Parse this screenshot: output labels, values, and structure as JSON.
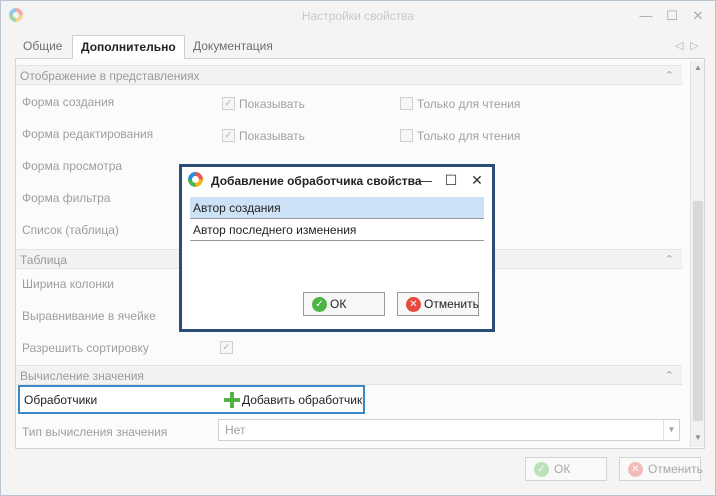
{
  "window": {
    "title": "Настройки свойства"
  },
  "tabs": [
    {
      "label": "Общие"
    },
    {
      "label": "Дополнительно"
    },
    {
      "label": "Документация"
    }
  ],
  "sections": {
    "display": {
      "header": "Отображение в представлениях",
      "rows": [
        {
          "label": "Форма создания",
          "show_label": "Показывать",
          "readonly_label": "Только для чтения"
        },
        {
          "label": "Форма редактирования",
          "show_label": "Показывать",
          "readonly_label": "Только для чтения"
        },
        {
          "label": "Форма просмотра"
        },
        {
          "label": "Форма фильтра"
        },
        {
          "label": "Список (таблица)"
        }
      ]
    },
    "table": {
      "header": "Таблица",
      "rows": [
        {
          "label": "Ширина колонки"
        },
        {
          "label": "Выравнивание в ячейке"
        },
        {
          "label": "Разрешить сортировку"
        }
      ]
    },
    "calc": {
      "header": "Вычисление значения",
      "handlers_label": "Обработчики",
      "add_handler_label": "Добавить обработчик",
      "calc_type_label": "Тип вычисления значения",
      "calc_type_value": "Нет"
    }
  },
  "footer": {
    "ok_label": "ОК",
    "cancel_label": "Отменить"
  },
  "dialog": {
    "title": "Добавление обработчика свойства",
    "items": [
      {
        "label": "Автор создания",
        "selected": true
      },
      {
        "label": "Автор последнего изменения",
        "selected": false
      }
    ],
    "ok_label": "ОК",
    "cancel_label": "Отменить"
  },
  "icons": {
    "app": "app-logo-icon",
    "add": "plus-icon",
    "ok": "check-circle-icon",
    "cancel": "x-circle-icon"
  },
  "colors": {
    "accent": "#3a87c9",
    "dialog_border": "#2c4d76",
    "selected_row": "#cde2f7",
    "ok_green": "#4cb544",
    "cancel_red": "#e54a3c"
  }
}
